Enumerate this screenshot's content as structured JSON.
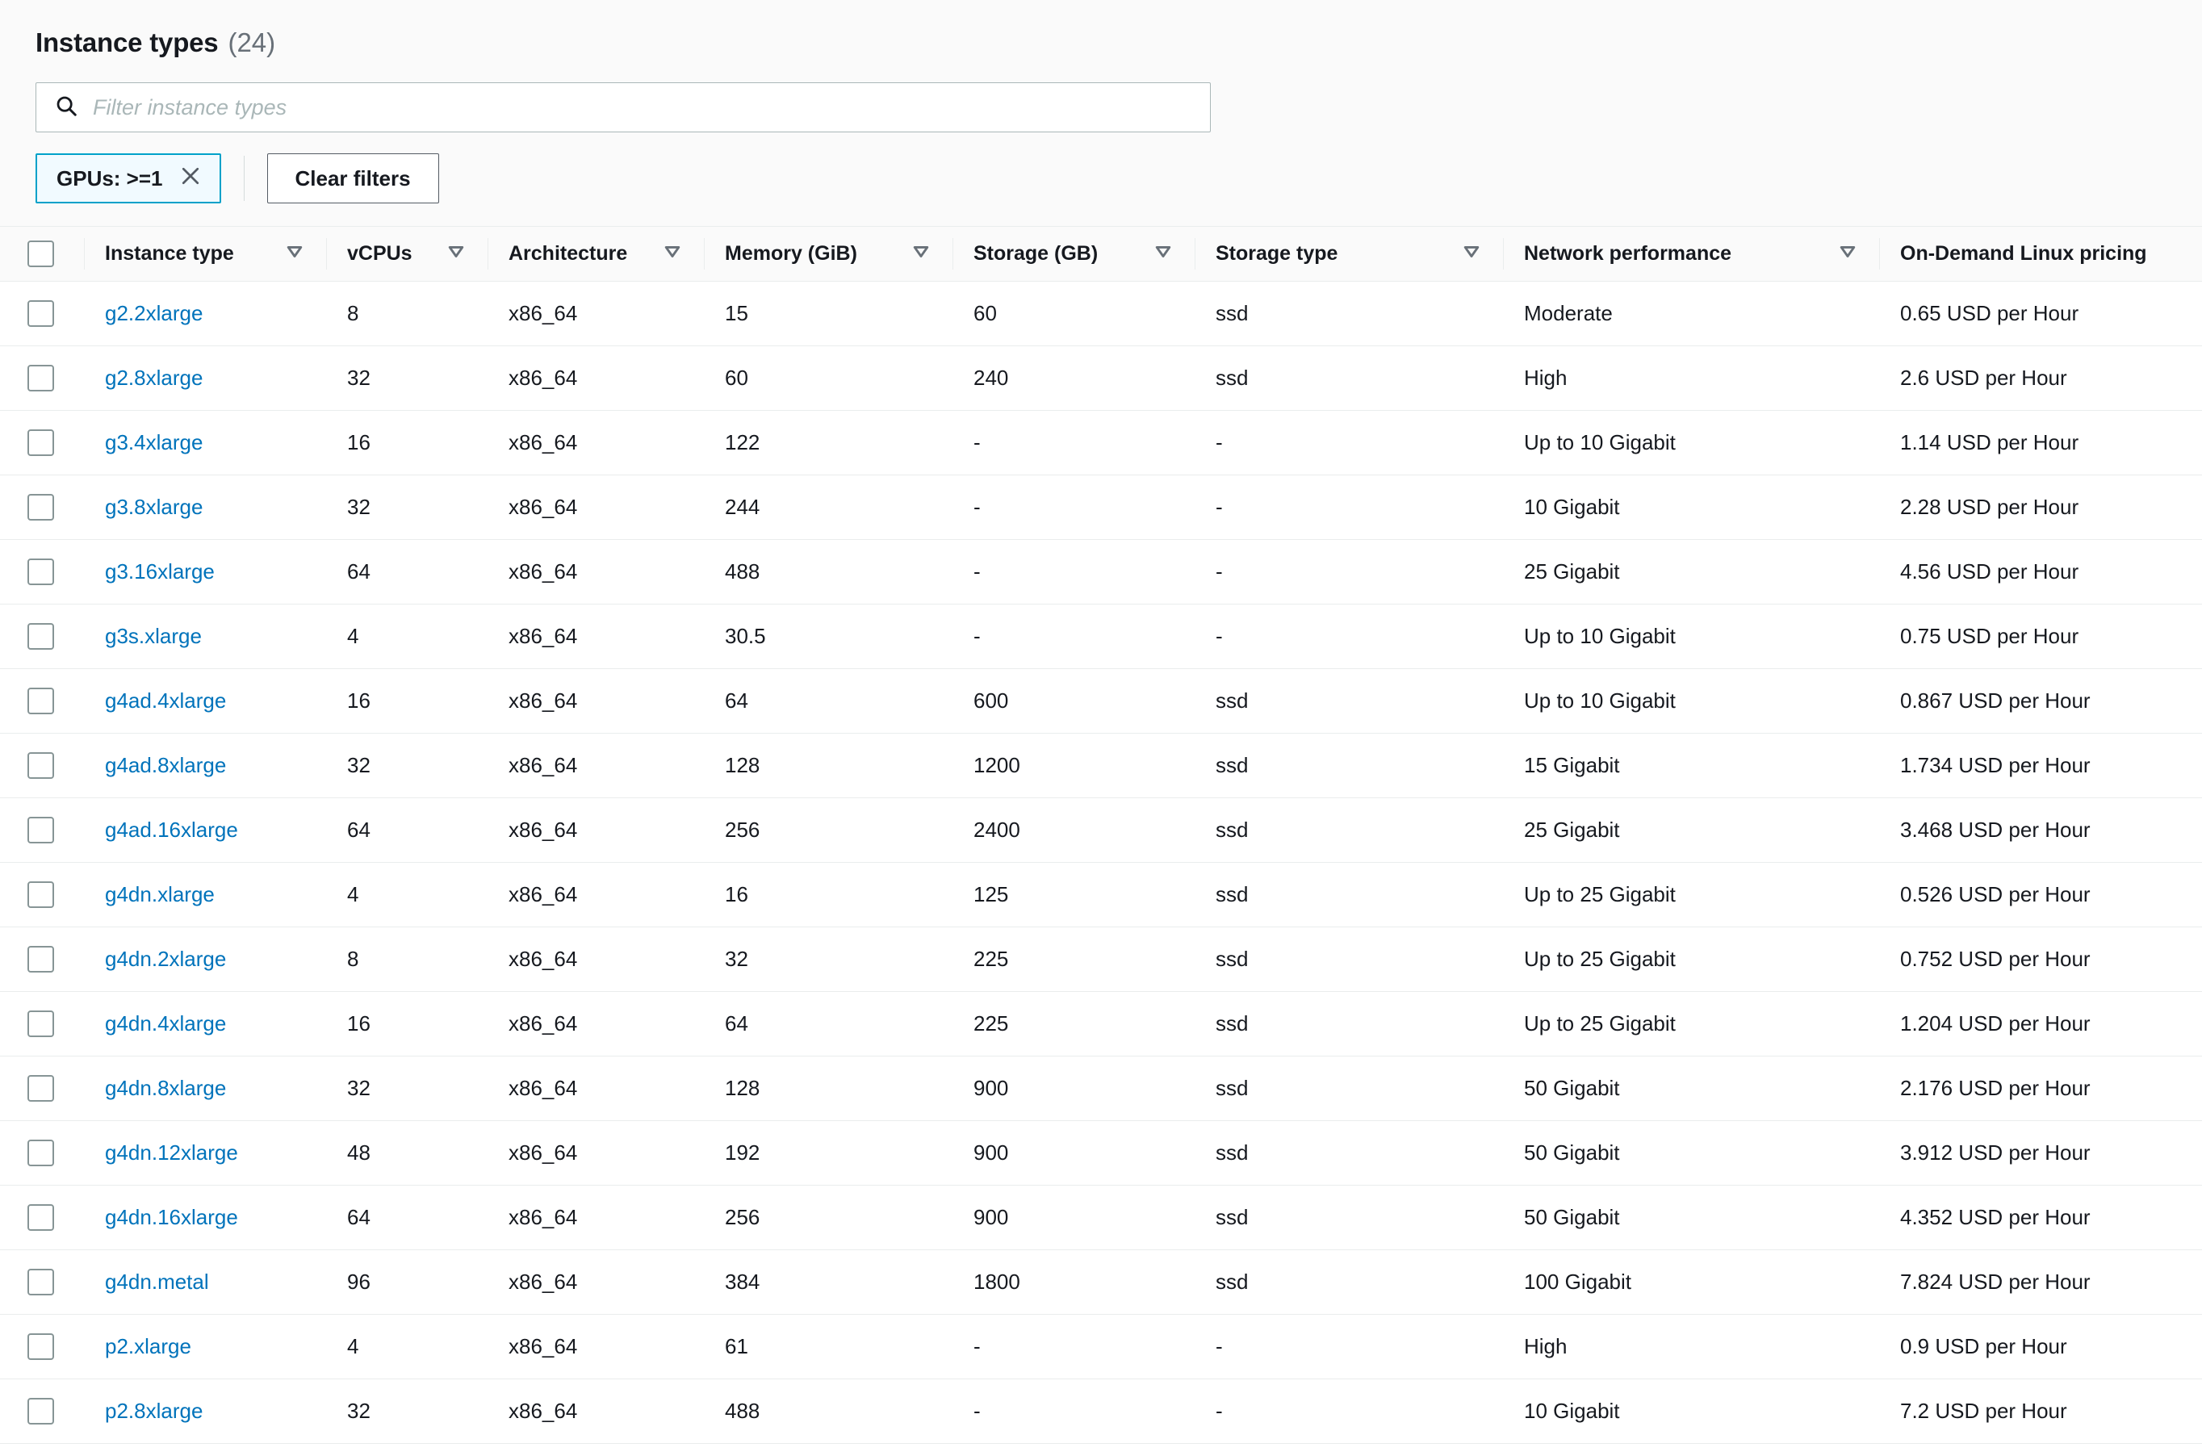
{
  "header": {
    "title": "Instance types",
    "count": "(24)"
  },
  "search": {
    "placeholder": "Filter instance types",
    "value": "",
    "icon": "search-icon"
  },
  "filters": {
    "token_label": "GPUs: >=1",
    "token_dismiss_icon": "close-icon",
    "clear_label": "Clear filters"
  },
  "table": {
    "columns": [
      {
        "label": "Instance type",
        "sortable": true
      },
      {
        "label": "vCPUs",
        "sortable": true
      },
      {
        "label": "Architecture",
        "sortable": true
      },
      {
        "label": "Memory (GiB)",
        "sortable": true
      },
      {
        "label": "Storage (GB)",
        "sortable": true
      },
      {
        "label": "Storage type",
        "sortable": true
      },
      {
        "label": "Network performance",
        "sortable": true
      },
      {
        "label": "On-Demand Linux pricing",
        "sortable": false
      }
    ],
    "rows": [
      {
        "instance_type": "g2.2xlarge",
        "vcpus": "8",
        "architecture": "x86_64",
        "memory": "15",
        "storage": "60",
        "storage_type": "ssd",
        "network": "Moderate",
        "price": "0.65 USD per Hour"
      },
      {
        "instance_type": "g2.8xlarge",
        "vcpus": "32",
        "architecture": "x86_64",
        "memory": "60",
        "storage": "240",
        "storage_type": "ssd",
        "network": "High",
        "price": "2.6 USD per Hour"
      },
      {
        "instance_type": "g3.4xlarge",
        "vcpus": "16",
        "architecture": "x86_64",
        "memory": "122",
        "storage": "-",
        "storage_type": "-",
        "network": "Up to 10 Gigabit",
        "price": "1.14 USD per Hour"
      },
      {
        "instance_type": "g3.8xlarge",
        "vcpus": "32",
        "architecture": "x86_64",
        "memory": "244",
        "storage": "-",
        "storage_type": "-",
        "network": "10 Gigabit",
        "price": "2.28 USD per Hour"
      },
      {
        "instance_type": "g3.16xlarge",
        "vcpus": "64",
        "architecture": "x86_64",
        "memory": "488",
        "storage": "-",
        "storage_type": "-",
        "network": "25 Gigabit",
        "price": "4.56 USD per Hour"
      },
      {
        "instance_type": "g3s.xlarge",
        "vcpus": "4",
        "architecture": "x86_64",
        "memory": "30.5",
        "storage": "-",
        "storage_type": "-",
        "network": "Up to 10 Gigabit",
        "price": "0.75 USD per Hour"
      },
      {
        "instance_type": "g4ad.4xlarge",
        "vcpus": "16",
        "architecture": "x86_64",
        "memory": "64",
        "storage": "600",
        "storage_type": "ssd",
        "network": "Up to 10 Gigabit",
        "price": "0.867 USD per Hour"
      },
      {
        "instance_type": "g4ad.8xlarge",
        "vcpus": "32",
        "architecture": "x86_64",
        "memory": "128",
        "storage": "1200",
        "storage_type": "ssd",
        "network": "15 Gigabit",
        "price": "1.734 USD per Hour"
      },
      {
        "instance_type": "g4ad.16xlarge",
        "vcpus": "64",
        "architecture": "x86_64",
        "memory": "256",
        "storage": "2400",
        "storage_type": "ssd",
        "network": "25 Gigabit",
        "price": "3.468 USD per Hour"
      },
      {
        "instance_type": "g4dn.xlarge",
        "vcpus": "4",
        "architecture": "x86_64",
        "memory": "16",
        "storage": "125",
        "storage_type": "ssd",
        "network": "Up to 25 Gigabit",
        "price": "0.526 USD per Hour"
      },
      {
        "instance_type": "g4dn.2xlarge",
        "vcpus": "8",
        "architecture": "x86_64",
        "memory": "32",
        "storage": "225",
        "storage_type": "ssd",
        "network": "Up to 25 Gigabit",
        "price": "0.752 USD per Hour"
      },
      {
        "instance_type": "g4dn.4xlarge",
        "vcpus": "16",
        "architecture": "x86_64",
        "memory": "64",
        "storage": "225",
        "storage_type": "ssd",
        "network": "Up to 25 Gigabit",
        "price": "1.204 USD per Hour"
      },
      {
        "instance_type": "g4dn.8xlarge",
        "vcpus": "32",
        "architecture": "x86_64",
        "memory": "128",
        "storage": "900",
        "storage_type": "ssd",
        "network": "50 Gigabit",
        "price": "2.176 USD per Hour"
      },
      {
        "instance_type": "g4dn.12xlarge",
        "vcpus": "48",
        "architecture": "x86_64",
        "memory": "192",
        "storage": "900",
        "storage_type": "ssd",
        "network": "50 Gigabit",
        "price": "3.912 USD per Hour"
      },
      {
        "instance_type": "g4dn.16xlarge",
        "vcpus": "64",
        "architecture": "x86_64",
        "memory": "256",
        "storage": "900",
        "storage_type": "ssd",
        "network": "50 Gigabit",
        "price": "4.352 USD per Hour"
      },
      {
        "instance_type": "g4dn.metal",
        "vcpus": "96",
        "architecture": "x86_64",
        "memory": "384",
        "storage": "1800",
        "storage_type": "ssd",
        "network": "100 Gigabit",
        "price": "7.824 USD per Hour"
      },
      {
        "instance_type": "p2.xlarge",
        "vcpus": "4",
        "architecture": "x86_64",
        "memory": "61",
        "storage": "-",
        "storage_type": "-",
        "network": "High",
        "price": "0.9 USD per Hour"
      },
      {
        "instance_type": "p2.8xlarge",
        "vcpus": "32",
        "architecture": "x86_64",
        "memory": "488",
        "storage": "-",
        "storage_type": "-",
        "network": "10 Gigabit",
        "price": "7.2 USD per Hour"
      }
    ]
  },
  "colors": {
    "link": "#0073bb",
    "token_border": "#00a1c9",
    "token_bg": "#f1faff",
    "header_bg": "#fafafa",
    "text": "#16191f",
    "muted": "#687078",
    "border": "#eaeded"
  }
}
